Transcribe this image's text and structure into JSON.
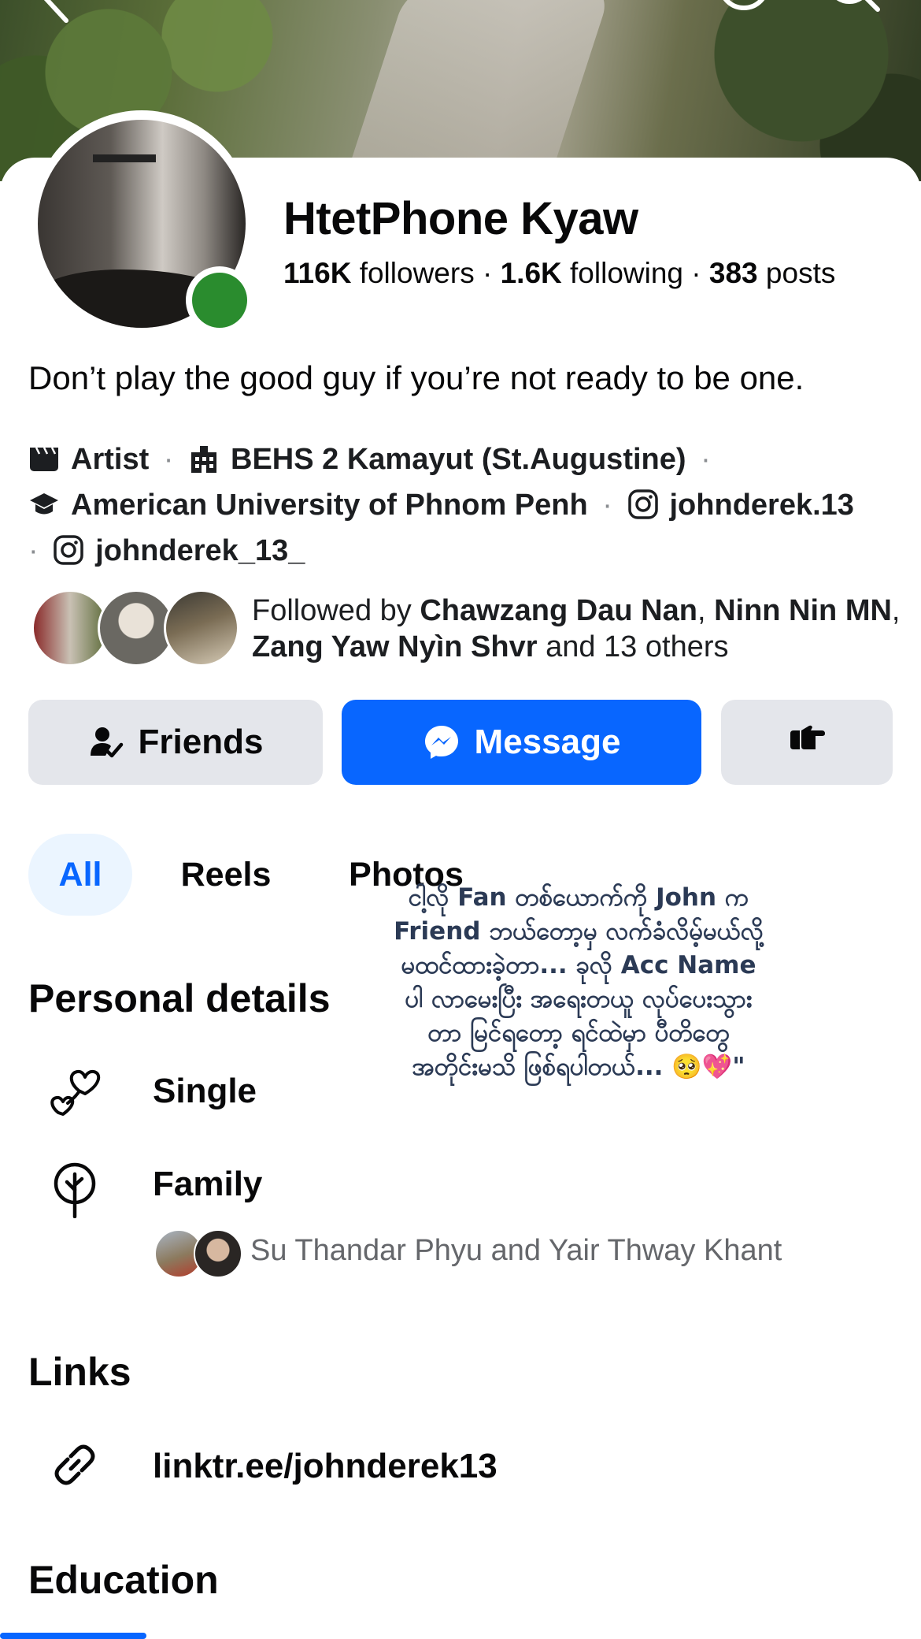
{
  "profile": {
    "name": "HtetPhone Kyaw",
    "followers_count": "116K",
    "followers_label": "followers",
    "following_count": "1.6K",
    "following_label": "following",
    "posts_count": "383",
    "posts_label": "posts",
    "bio": "Don’t play the good guy if you’re not ready to be one.",
    "online": true
  },
  "intro": {
    "items": [
      {
        "icon": "clapperboard-icon",
        "text": "Artist"
      },
      {
        "icon": "school-building-icon",
        "text": "BEHS 2 Kamayut (St.Augustine)"
      },
      {
        "icon": "graduation-cap-icon",
        "text": "American University of Phnom Penh"
      },
      {
        "icon": "instagram-icon",
        "text": "johnderek.13"
      },
      {
        "icon": "instagram-icon",
        "text": "johnderek_13_"
      }
    ],
    "separator": "·"
  },
  "followed_by": {
    "prefix": "Followed by",
    "name1": "Chawzang Dau Nan",
    "name2": "Ninn Nin MN",
    "name3": "Zang Yaw Nyìn Shvr",
    "suffix": "and 13 others"
  },
  "actions": {
    "friends_label": "Friends",
    "message_label": "Message"
  },
  "tabs": [
    {
      "label": "All",
      "active": true
    },
    {
      "label": "Reels",
      "active": false
    },
    {
      "label": "Photos",
      "active": false
    }
  ],
  "overlay_text": "ငါ့လို Fan တစ်ယောက်ကို John က Friend ဘယ်တော့မှ လက်ခံလိမ့်မယ်လို့ မထင်ထားခဲ့တာ... ခုလို Acc Name ပါ လာမေးပြီး အရေးတယူ လုပ်ပေးသွားတာ မြင်ရတော့ ရင်ထဲမှာ ပီတိတွေ အတိုင်းမသိ ဖြစ်ရပါတယ်... 🥺💖\"",
  "personal_details": {
    "heading": "Personal details",
    "relationship": "Single",
    "family_label": "Family",
    "family_members": "Su Thandar Phyu and Yair Thway Khant"
  },
  "links": {
    "heading": "Links",
    "url": "linktr.ee/johnderek13"
  },
  "education": {
    "heading": "Education"
  },
  "colors": {
    "accent": "#0866ff",
    "online": "#2a8c2e",
    "button_gray": "#e4e6eb",
    "tab_active_bg": "#ebf5ff"
  }
}
